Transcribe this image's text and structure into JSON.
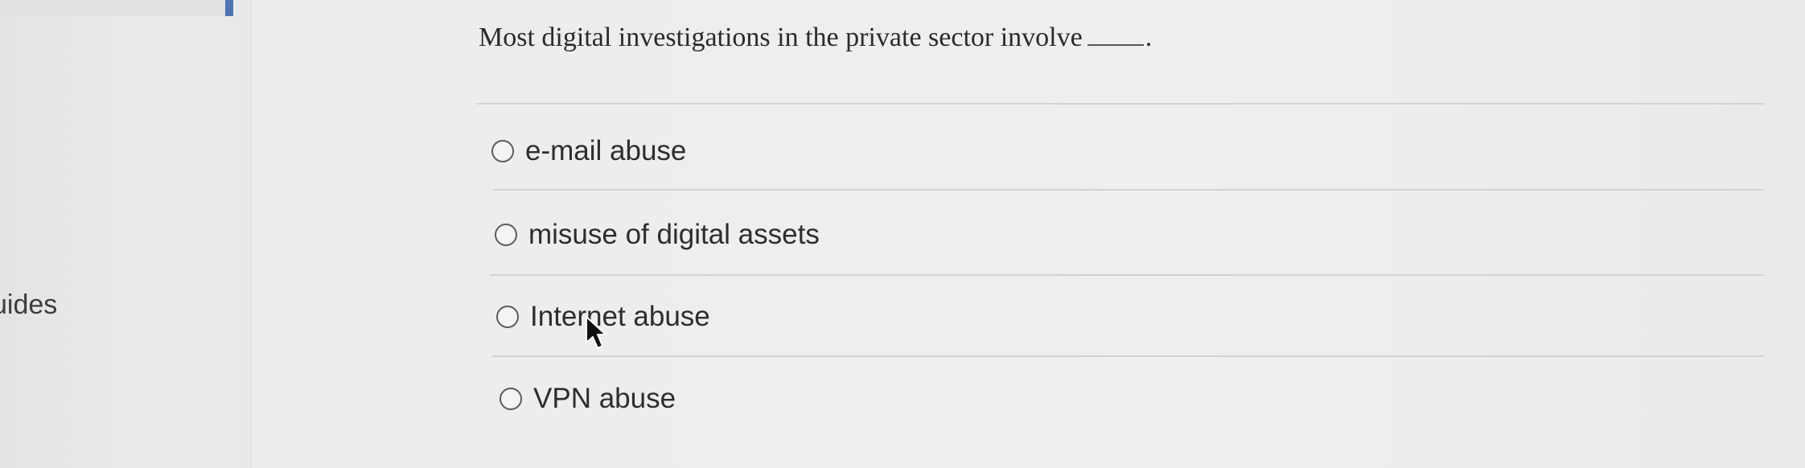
{
  "sidebar": {
    "partial_label": "uides"
  },
  "question": {
    "text": "Most digital investigations in the private sector involve",
    "end_punctuation": "."
  },
  "options": [
    {
      "label": "e-mail abuse",
      "selected": false
    },
    {
      "label": "misuse of digital assets",
      "selected": false
    },
    {
      "label": "Internet abuse",
      "selected": false
    },
    {
      "label": "VPN abuse",
      "selected": false
    }
  ],
  "icons": {
    "cursor": "mouse-pointer-icon",
    "radio": "radio-unselected-icon"
  },
  "colors": {
    "accent": "#4f74b3",
    "text": "#2d2d2d",
    "background": "#ececec"
  }
}
